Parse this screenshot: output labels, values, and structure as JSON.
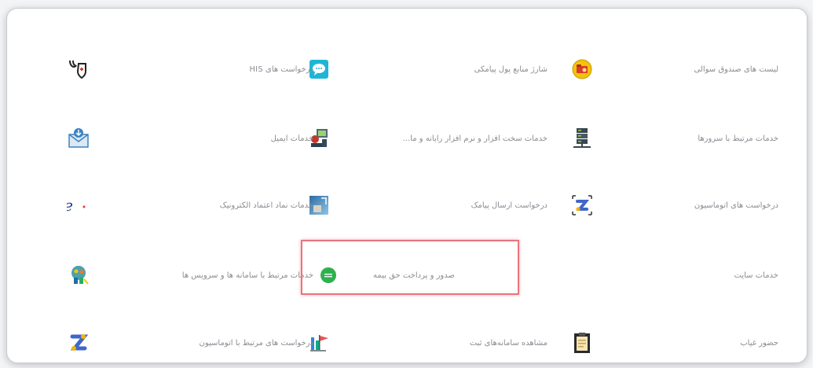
{
  "services": {
    "row1": {
      "right": {
        "label": "لیست های صندوق سوالی",
        "icon": "folder-coin-icon"
      },
      "middle": {
        "label": "شارژ منابع پول پیامکی",
        "icon": "chat-bubble-icon"
      },
      "left": {
        "label": "درخواست های HIS",
        "icon": "stethoscope-shield-icon"
      }
    },
    "row2": {
      "right": {
        "label": "خدمات مرتبط با سرورها",
        "icon": "server-icon"
      },
      "middle": {
        "label": "خدمات سخت افزار و نرم افزار رایانه و ما...",
        "icon": "computer-repair-icon"
      },
      "left": {
        "label": "خدمات ایمیل",
        "icon": "email-download-icon"
      }
    },
    "row3": {
      "right": {
        "label": "درخواست های اتوماسیون",
        "icon": "automation-icon"
      },
      "middle": {
        "label": "درخواست ارسال پیامک",
        "icon": "sms-image-icon"
      },
      "left": {
        "label": "خدمات نماد اعتماد الکترونیک",
        "icon": "e-trust-icon"
      }
    },
    "row4": {
      "right": {
        "label": "خدمات سایت",
        "icon": ""
      },
      "middle": {
        "label": "صدور و پرداخت حق بیمه",
        "icon": "green-circle-icon"
      },
      "left": {
        "label": "خدمات مرتبط با سامانه ها و سرویس ها",
        "icon": "network-people-icon"
      }
    },
    "row5": {
      "right": {
        "label": "حضور غیاب",
        "icon": "attendance-board-icon"
      },
      "middle": {
        "label": "مشاهده سامانه‌های ثبت",
        "icon": "chart-flag-icon"
      },
      "left": {
        "label": "درخواست های مرتبط با اتوماسیون",
        "icon": "automation-logo-icon"
      }
    }
  },
  "colors": {
    "highlight": "#e8757d",
    "label": "#8a8d93",
    "panel_border": "#c9ccd2"
  }
}
